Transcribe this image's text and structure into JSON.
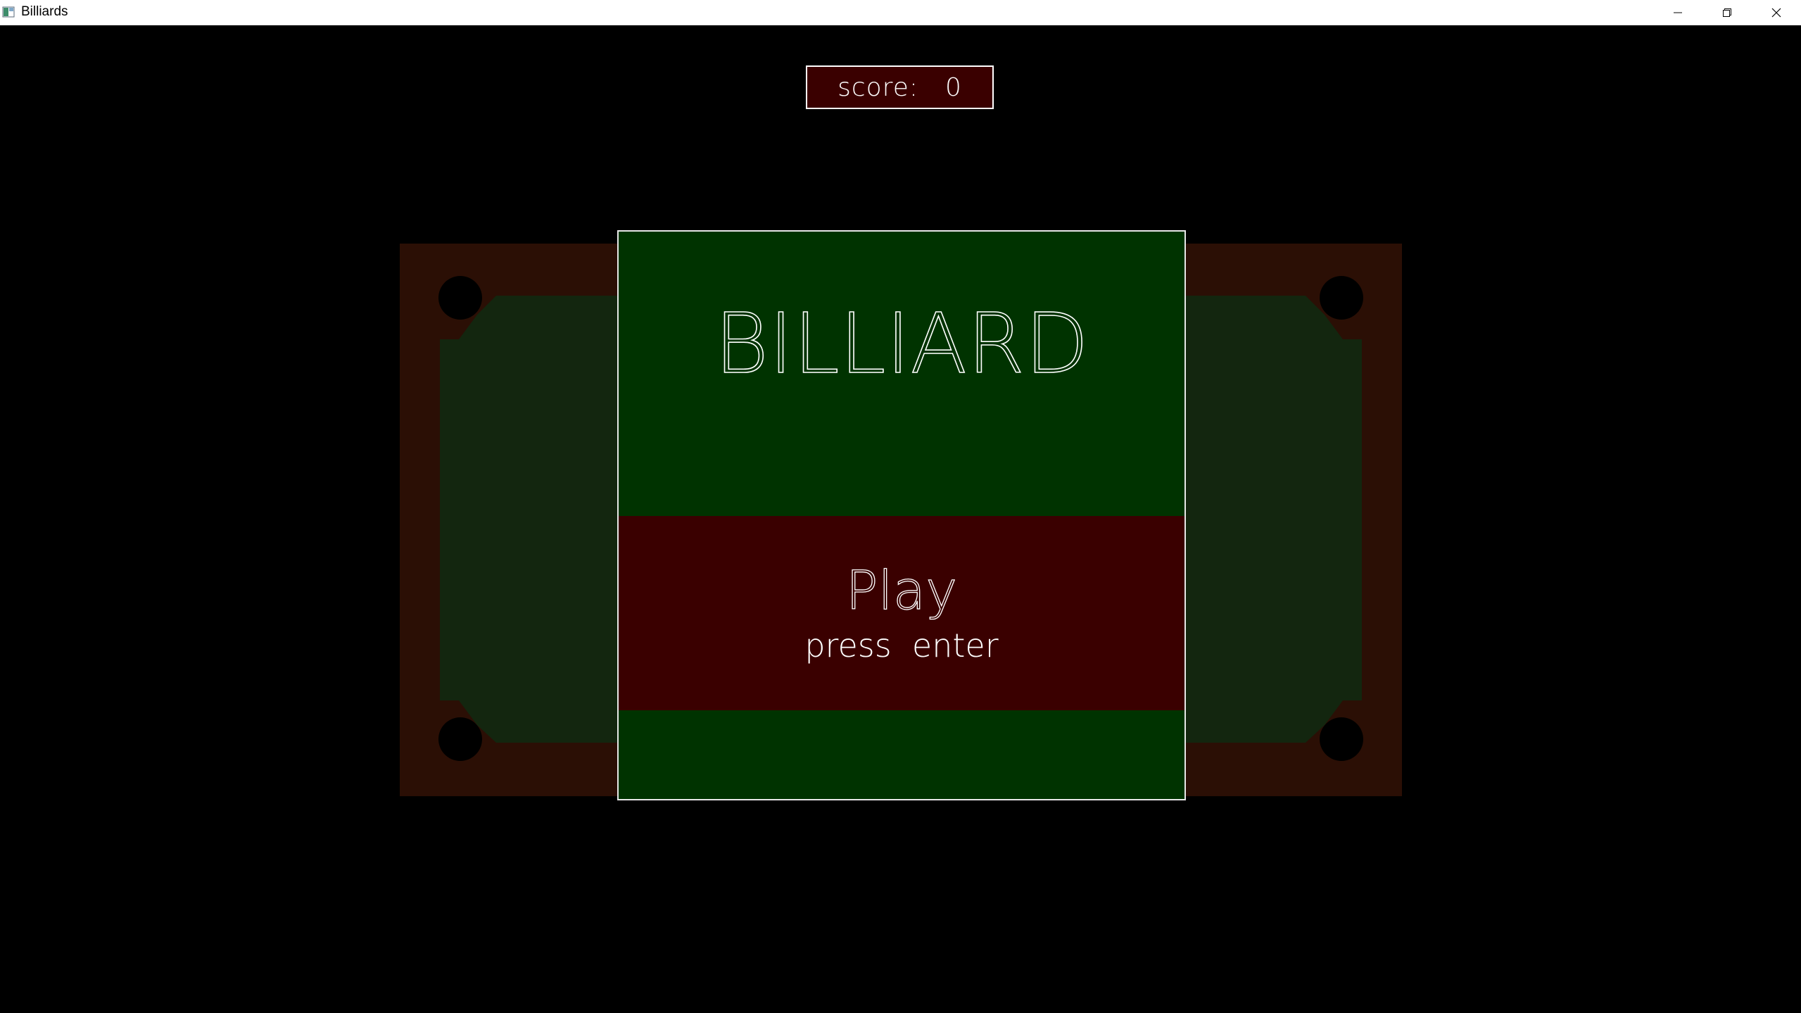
{
  "window": {
    "title": "Billiards",
    "icon": "app-icon",
    "controls": [
      "minimize-icon",
      "restore-icon",
      "close-icon"
    ]
  },
  "hud": {
    "score_label": "score:",
    "score_value": "0"
  },
  "menu": {
    "title": "BILLIARD",
    "play_label": "Play",
    "play_hint": "press  enter"
  },
  "colors": {
    "background": "#000000",
    "table_wood": "#2b0f05",
    "table_felt": "#13260f",
    "pocket": "#000000",
    "panel_green": "#003300",
    "play_band": "#3a0000",
    "text": "#ffffff"
  }
}
